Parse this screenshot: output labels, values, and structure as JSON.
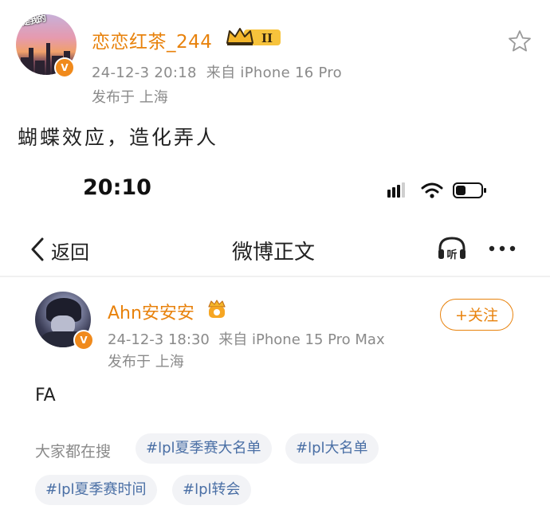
{
  "outer_post": {
    "username": "恋恋红茶_244",
    "avatar_sticker_text": "你是我的",
    "member_level": "II",
    "meta": "24-12-3 20:18  来自 iPhone 16 Pro",
    "location": "发布于 上海",
    "text": "蝴蝶效应，造化弄人"
  },
  "embedded": {
    "status_bar": {
      "time": "20:10"
    },
    "nav": {
      "back_label": "返回",
      "title": "微博正文",
      "listen_label": "听"
    },
    "post": {
      "username": "Ahn安安安",
      "follow_label": "+关注",
      "meta": "24-12-3 18:30  来自 iPhone 15 Pro Max",
      "location": "发布于 上海",
      "text": "FA"
    },
    "search": {
      "label": "大家都在搜",
      "tags": [
        "#lpl夏季赛大名单",
        "#lpl大名单",
        "#lpl夏季赛时间",
        "#lpl转会"
      ]
    }
  },
  "colors": {
    "accent": "#e8820c",
    "tag_text": "#4a6fa5",
    "meta_gray": "#8a8a8a"
  },
  "icons": [
    "star-icon",
    "crown-icon",
    "verified-badge-icon",
    "signal-icon",
    "wifi-icon",
    "battery-icon",
    "back-chevron-icon",
    "headphones-icon",
    "more-icon",
    "vip-badge-icon"
  ]
}
